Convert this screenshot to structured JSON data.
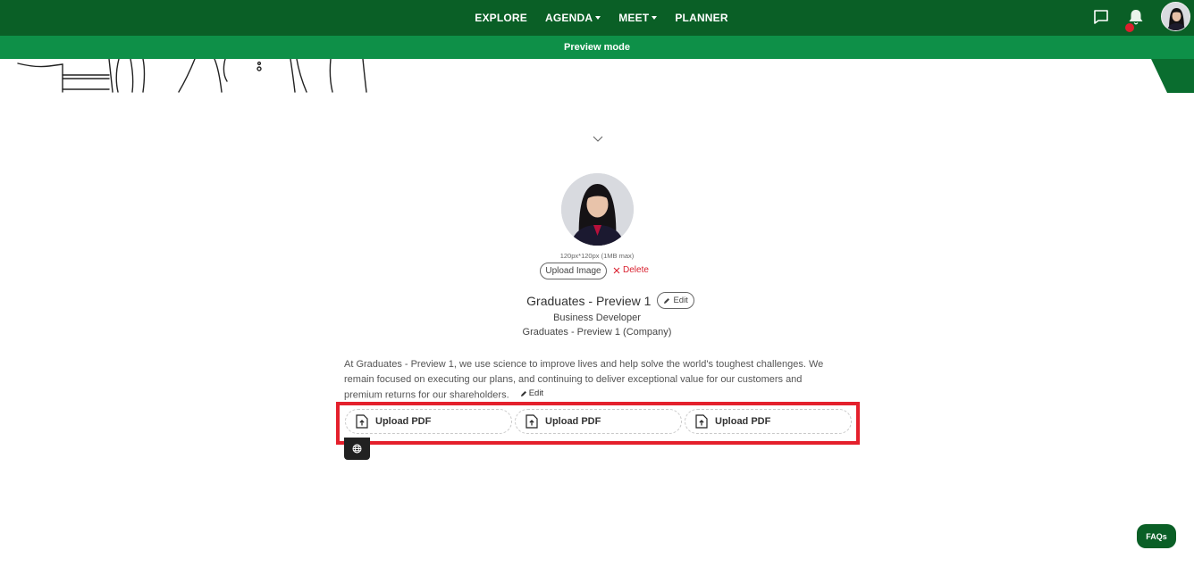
{
  "nav": {
    "items": [
      {
        "label": "EXPLORE",
        "has_caret": false
      },
      {
        "label": "AGENDA",
        "has_caret": true
      },
      {
        "label": "MEET",
        "has_caret": true
      },
      {
        "label": "PLANNER",
        "has_caret": false
      }
    ],
    "icons": [
      "chat-icon",
      "bell-icon",
      "avatar"
    ],
    "notification_dot_color": "#dc1f2d"
  },
  "preview_bar": {
    "label": "Preview mode"
  },
  "profile": {
    "image_hint": "120px*120px (1MB max)",
    "upload_image_label": "Upload Image",
    "delete_label": "Delete",
    "name": "Graduates - Preview 1",
    "edit_label": "Edit",
    "job_title": "Business Developer",
    "company": "Graduates - Preview 1 (Company)",
    "bio": "At Graduates - Preview 1, we use science to improve lives and help solve the world's toughest challenges. We remain focused on executing our plans, and continuing to deliver exceptional value for our customers and premium returns for our shareholders.",
    "bio_edit_label": "Edit"
  },
  "uploads": [
    {
      "label": "Upload PDF",
      "icon": "file-upload-icon"
    },
    {
      "label": "Upload PDF",
      "icon": "file-upload-icon"
    },
    {
      "label": "Upload PDF",
      "icon": "file-upload-icon"
    }
  ],
  "faqs_label": "FAQs",
  "colors": {
    "nav_bg": "#0a5f26",
    "preview_bg": "#0e9048",
    "highlight": "#e4202c",
    "delete": "#d9202f"
  }
}
